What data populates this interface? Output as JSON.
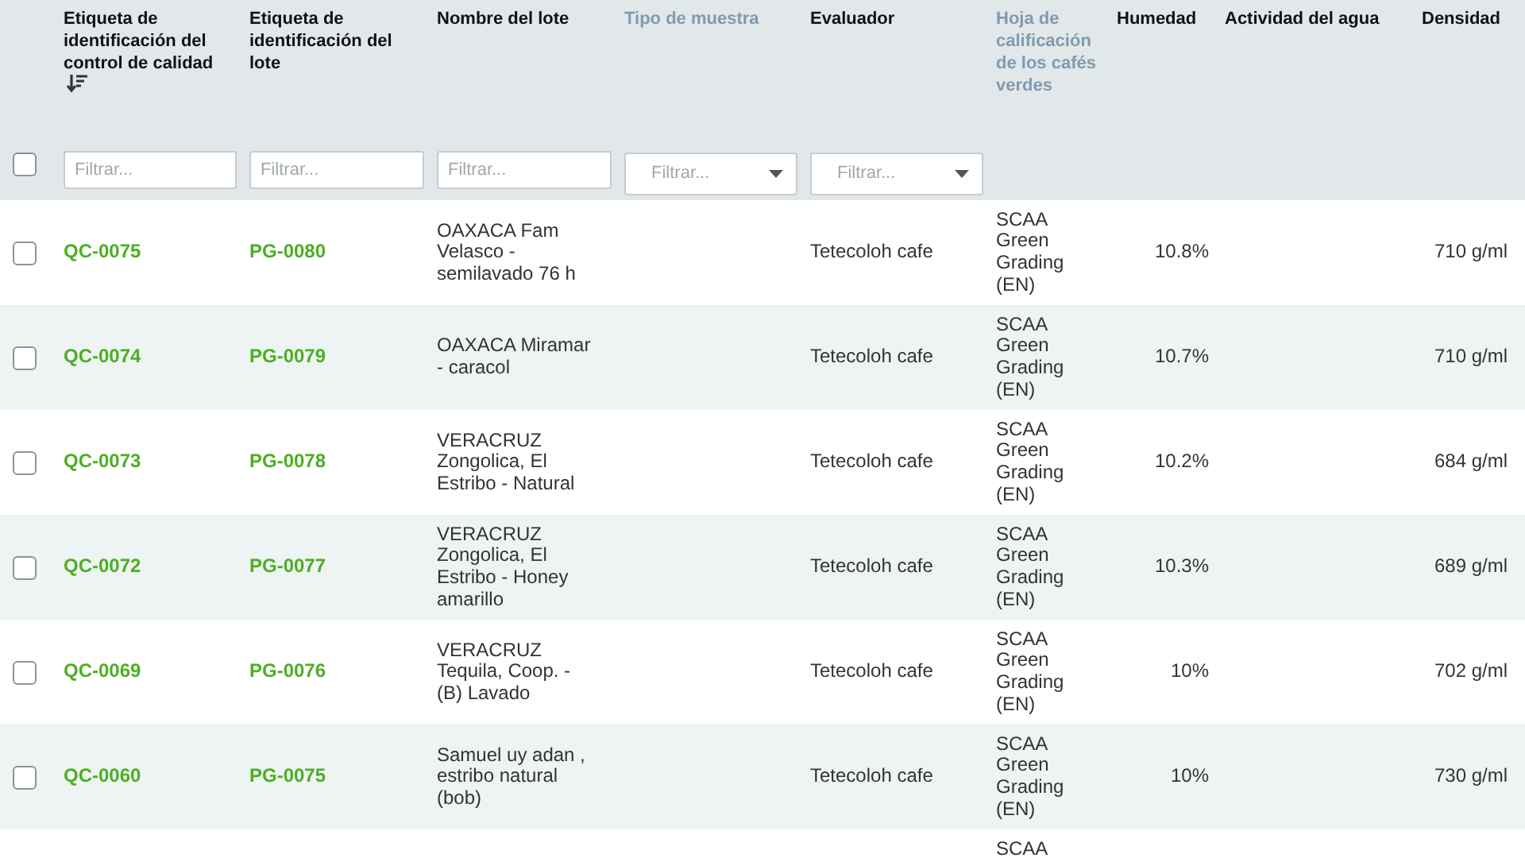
{
  "table": {
    "select_all": {
      "checked": false
    },
    "columns": [
      {
        "label": "Etiqueta de identificación del control de calidad",
        "dimmed": false,
        "sorted_descending": true,
        "filter": {
          "kind": "text",
          "placeholder": "Filtrar..."
        }
      },
      {
        "label": "Etiqueta de identificación del lote",
        "dimmed": false,
        "sorted_descending": false,
        "filter": {
          "kind": "text",
          "placeholder": "Filtrar..."
        }
      },
      {
        "label": "Nombre del lote",
        "dimmed": false,
        "sorted_descending": false,
        "filter": {
          "kind": "text",
          "placeholder": "Filtrar..."
        }
      },
      {
        "label": "Tipo de muestra",
        "dimmed": true,
        "sorted_descending": false,
        "filter": {
          "kind": "select",
          "placeholder": "Filtrar..."
        }
      },
      {
        "label": "Evaluador",
        "dimmed": false,
        "sorted_descending": false,
        "filter": {
          "kind": "select",
          "placeholder": "Filtrar..."
        }
      },
      {
        "label": "Hoja de calificación de los cafés verdes",
        "dimmed": true,
        "sorted_descending": false,
        "filter": {
          "kind": "none"
        }
      },
      {
        "label": "Humedad",
        "dimmed": false,
        "sorted_descending": false,
        "filter": {
          "kind": "none"
        }
      },
      {
        "label": "Actividad del agua",
        "dimmed": false,
        "sorted_descending": false,
        "filter": {
          "kind": "none"
        }
      },
      {
        "label": "Densidad",
        "dimmed": false,
        "sorted_descending": false,
        "filter": {
          "kind": "none"
        }
      }
    ],
    "rows": [
      {
        "checked": false,
        "cells": [
          {
            "kind": "link",
            "text": "QC-0075"
          },
          {
            "kind": "link",
            "text": "PG-0080"
          },
          {
            "kind": "text",
            "text": "OAXACA Fam Velasco - semilavado 76 h"
          },
          {
            "kind": "empty"
          },
          {
            "kind": "text",
            "text": "Tetecoloh cafe"
          },
          {
            "kind": "text",
            "text": "SCAA Green Grading (EN)"
          },
          {
            "kind": "number",
            "text": "10.8%"
          },
          {
            "kind": "empty"
          },
          {
            "kind": "number",
            "text": "710 g/ml"
          }
        ]
      },
      {
        "checked": false,
        "cells": [
          {
            "kind": "link",
            "text": "QC-0074"
          },
          {
            "kind": "link",
            "text": "PG-0079"
          },
          {
            "kind": "text",
            "text": "OAXACA Miramar - caracol"
          },
          {
            "kind": "empty"
          },
          {
            "kind": "text",
            "text": "Tetecoloh cafe"
          },
          {
            "kind": "text",
            "text": "SCAA Green Grading (EN)"
          },
          {
            "kind": "number",
            "text": "10.7%"
          },
          {
            "kind": "empty"
          },
          {
            "kind": "number",
            "text": "710 g/ml"
          }
        ]
      },
      {
        "checked": false,
        "cells": [
          {
            "kind": "link",
            "text": "QC-0073"
          },
          {
            "kind": "link",
            "text": "PG-0078"
          },
          {
            "kind": "text",
            "text": "VERACRUZ Zongolica, El Estribo - Natural"
          },
          {
            "kind": "empty"
          },
          {
            "kind": "text",
            "text": "Tetecoloh cafe"
          },
          {
            "kind": "text",
            "text": "SCAA Green Grading (EN)"
          },
          {
            "kind": "number",
            "text": "10.2%"
          },
          {
            "kind": "empty"
          },
          {
            "kind": "number",
            "text": "684 g/ml"
          }
        ]
      },
      {
        "checked": false,
        "cells": [
          {
            "kind": "link",
            "text": "QC-0072"
          },
          {
            "kind": "link",
            "text": "PG-0077"
          },
          {
            "kind": "text",
            "text": "VERACRUZ Zongolica, El Estribo - Honey amarillo"
          },
          {
            "kind": "empty"
          },
          {
            "kind": "text",
            "text": "Tetecoloh cafe"
          },
          {
            "kind": "text",
            "text": "SCAA Green Grading (EN)"
          },
          {
            "kind": "number",
            "text": "10.3%"
          },
          {
            "kind": "empty"
          },
          {
            "kind": "number",
            "text": "689 g/ml"
          }
        ]
      },
      {
        "checked": false,
        "cells": [
          {
            "kind": "link",
            "text": "QC-0069"
          },
          {
            "kind": "link",
            "text": "PG-0076"
          },
          {
            "kind": "text",
            "text": "VERACRUZ Tequila, Coop. - (B) Lavado"
          },
          {
            "kind": "empty"
          },
          {
            "kind": "text",
            "text": "Tetecoloh cafe"
          },
          {
            "kind": "text",
            "text": "SCAA Green Grading (EN)"
          },
          {
            "kind": "number",
            "text": "10%"
          },
          {
            "kind": "empty"
          },
          {
            "kind": "number",
            "text": "702 g/ml"
          }
        ]
      },
      {
        "checked": false,
        "cells": [
          {
            "kind": "link",
            "text": "QC-0060"
          },
          {
            "kind": "link",
            "text": "PG-0075"
          },
          {
            "kind": "text",
            "text": "Samuel uy adan , estribo natural (bob)"
          },
          {
            "kind": "empty"
          },
          {
            "kind": "text",
            "text": "Tetecoloh cafe"
          },
          {
            "kind": "text",
            "text": "SCAA Green Grading (EN)"
          },
          {
            "kind": "number",
            "text": "10%"
          },
          {
            "kind": "empty"
          },
          {
            "kind": "number",
            "text": "730 g/ml"
          }
        ]
      }
    ],
    "partial_row": {
      "cells": [
        {
          "kind": "empty"
        },
        {
          "kind": "empty"
        },
        {
          "kind": "empty"
        },
        {
          "kind": "empty"
        },
        {
          "kind": "empty"
        },
        {
          "kind": "text",
          "text": "SCAA"
        },
        {
          "kind": "empty"
        },
        {
          "kind": "empty"
        },
        {
          "kind": "empty"
        }
      ]
    }
  }
}
